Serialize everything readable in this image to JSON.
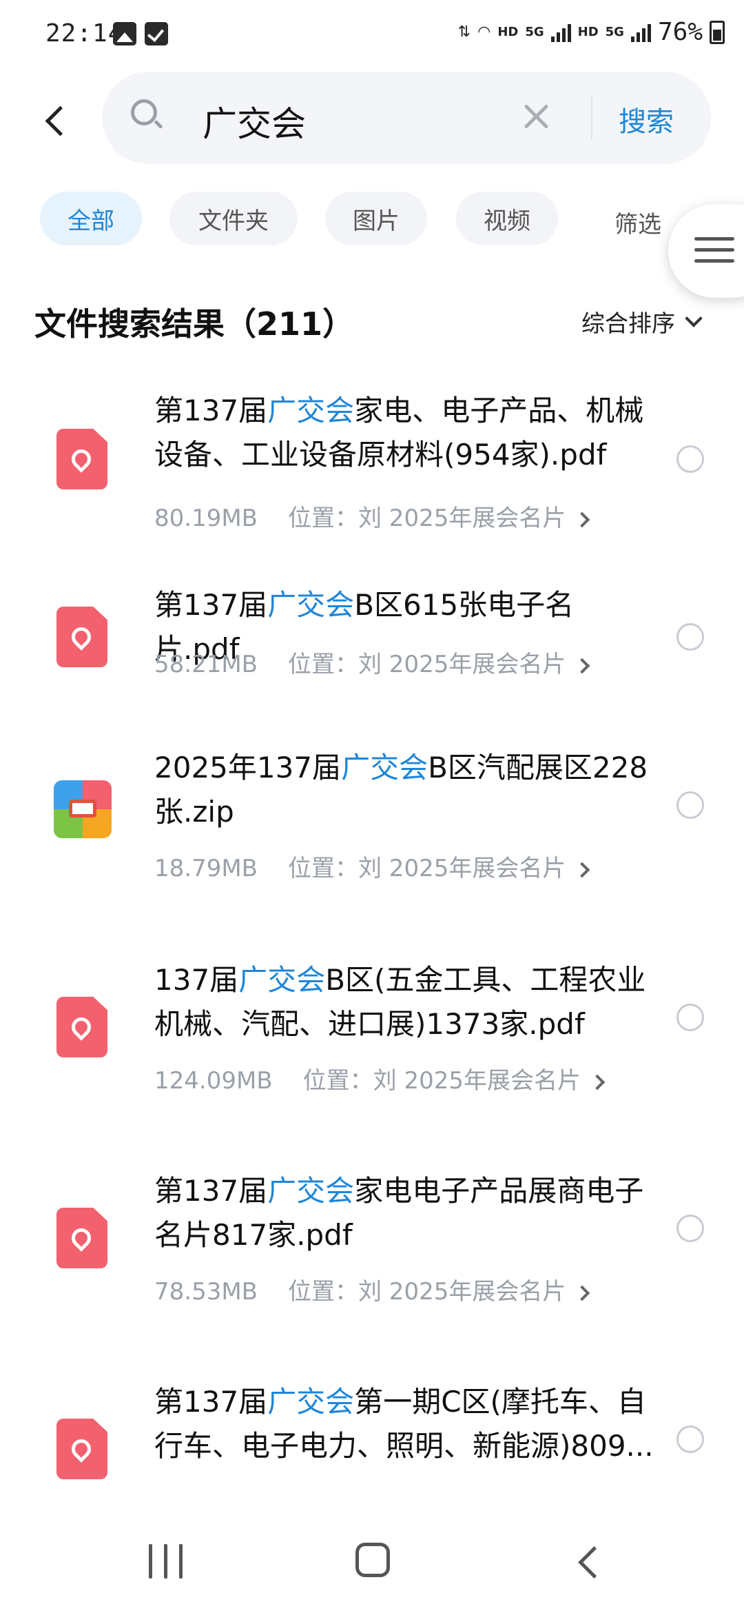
{
  "status_bar": {
    "time": "22:14",
    "net_tags": [
      "HD",
      "5G",
      "HD",
      "5G"
    ],
    "battery": "76%"
  },
  "search": {
    "query": "广交会",
    "submit_label": "搜索"
  },
  "tabs": [
    {
      "label": "全部",
      "active": true
    },
    {
      "label": "文件夹",
      "active": false
    },
    {
      "label": "图片",
      "active": false
    },
    {
      "label": "视频",
      "active": false
    }
  ],
  "filter_label": "筛选",
  "results": {
    "title": "文件搜索结果（211）",
    "sort_label": "综合排序"
  },
  "files": [
    {
      "icon": "pdf-icon",
      "title_pre": "第137届",
      "title_hl": "广交会",
      "title_post": "家电、电子产品、机械设备、工业设备原材料(954家).pdf",
      "size": "80.19MB",
      "location": "位置：刘 2025年展会名片"
    },
    {
      "icon": "pdf-icon",
      "title_pre": "第137届",
      "title_hl": "广交会",
      "title_post": "B区615张电子名片.pdf",
      "size": "58.21MB",
      "location": "位置：刘 2025年展会名片"
    },
    {
      "icon": "zip-icon",
      "title_pre": "2025年137届",
      "title_hl": "广交会",
      "title_post": "B区汽配展区228张.zip",
      "size": "18.79MB",
      "location": "位置：刘 2025年展会名片"
    },
    {
      "icon": "pdf-icon",
      "title_pre": "137届",
      "title_hl": "广交会",
      "title_post": "B区(五金工具、工程农业机械、汽配、进口展)1373家.pdf",
      "size": "124.09MB",
      "location": "位置：刘 2025年展会名片"
    },
    {
      "icon": "pdf-icon",
      "title_pre": "第137届",
      "title_hl": "广交会",
      "title_post": "家电电子产品展商电子名片817家.pdf",
      "size": "78.53MB",
      "location": "位置：刘 2025年展会名片"
    },
    {
      "icon": "pdf-icon",
      "title_pre": "第137届",
      "title_hl": "广交会",
      "title_post": "第一期C区(摩托车、自行车、电子电力、照明、新能源)809...",
      "size": "",
      "location": ""
    }
  ],
  "colors": {
    "accent": "#1e86d8",
    "pdf": "#f2616d",
    "muted": "#9aa0a8"
  }
}
